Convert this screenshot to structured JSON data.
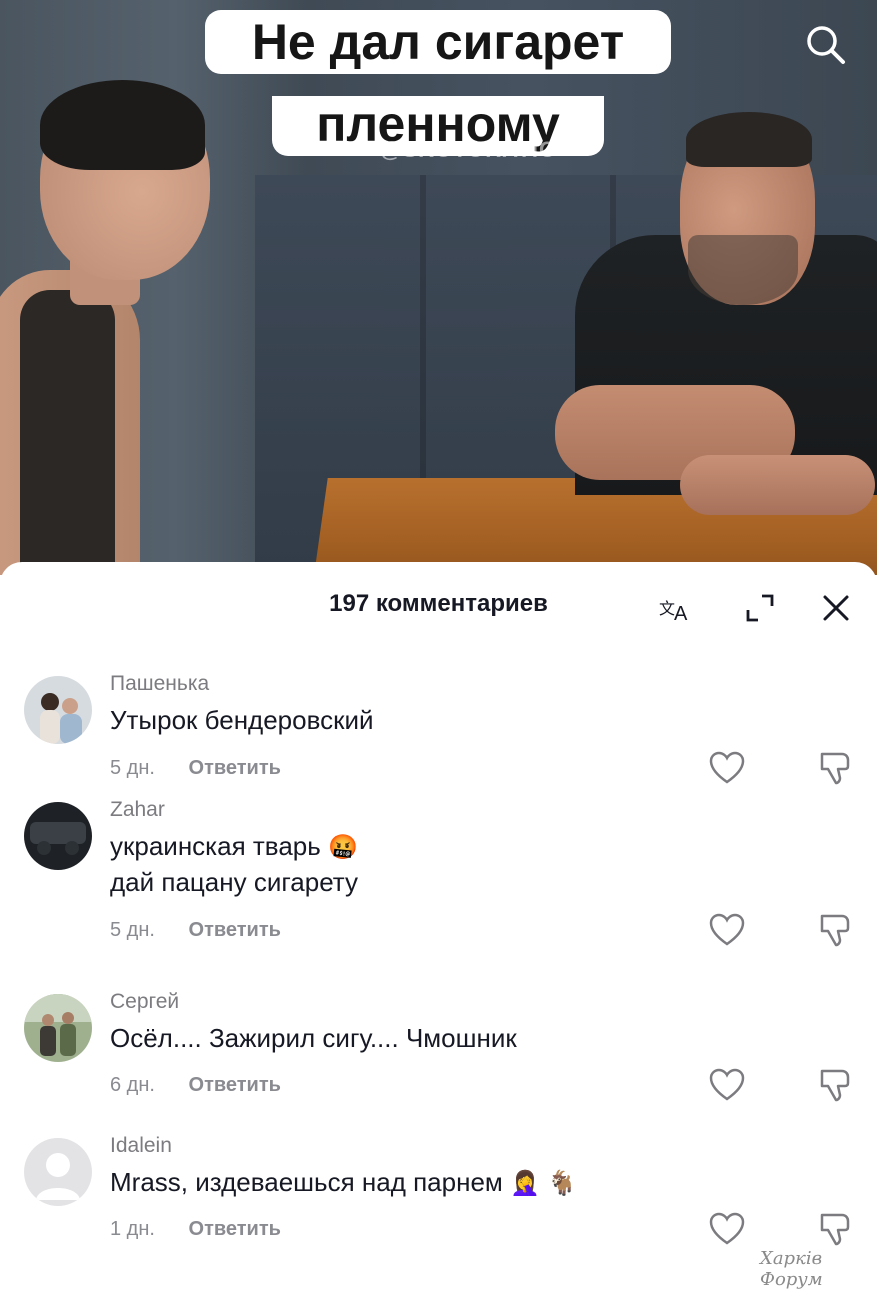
{
  "video": {
    "caption_line1": "Не дал сигарет",
    "caption_line2": "пленному",
    "watermark": "@SKOTORATIO"
  },
  "search": {
    "icon": "search-icon"
  },
  "sheet": {
    "title": "197 комментариев",
    "translate_icon": "translate-icon",
    "expand_icon": "expand-icon",
    "close_icon": "close-icon"
  },
  "comments": [
    {
      "user": "Пашенька",
      "text": "Утырок бендеровский",
      "date": "5 дн.",
      "reply": "Ответить"
    },
    {
      "user": "Zahar",
      "text_line1": "украинская тварь",
      "emoji1": "🤬",
      "text_line2": "дай пацану сигарету",
      "date": "5 дн.",
      "reply": "Ответить"
    },
    {
      "user": "Сергей",
      "text": "Осёл.... Зажирил сигу.... Чмошник",
      "date": "6 дн.",
      "reply": "Ответить"
    },
    {
      "user": "Idalein",
      "text": "Mrass, издеваешься над парнем",
      "emoji1": "🤦‍♀️",
      "emoji2": "🐐",
      "date": "1 дн.",
      "reply": "Ответить"
    }
  ],
  "forum_watermark": "Харків Форум",
  "colors": {
    "text": "#161823",
    "muted": "#8a8b91",
    "sheet_bg": "#ffffff"
  }
}
